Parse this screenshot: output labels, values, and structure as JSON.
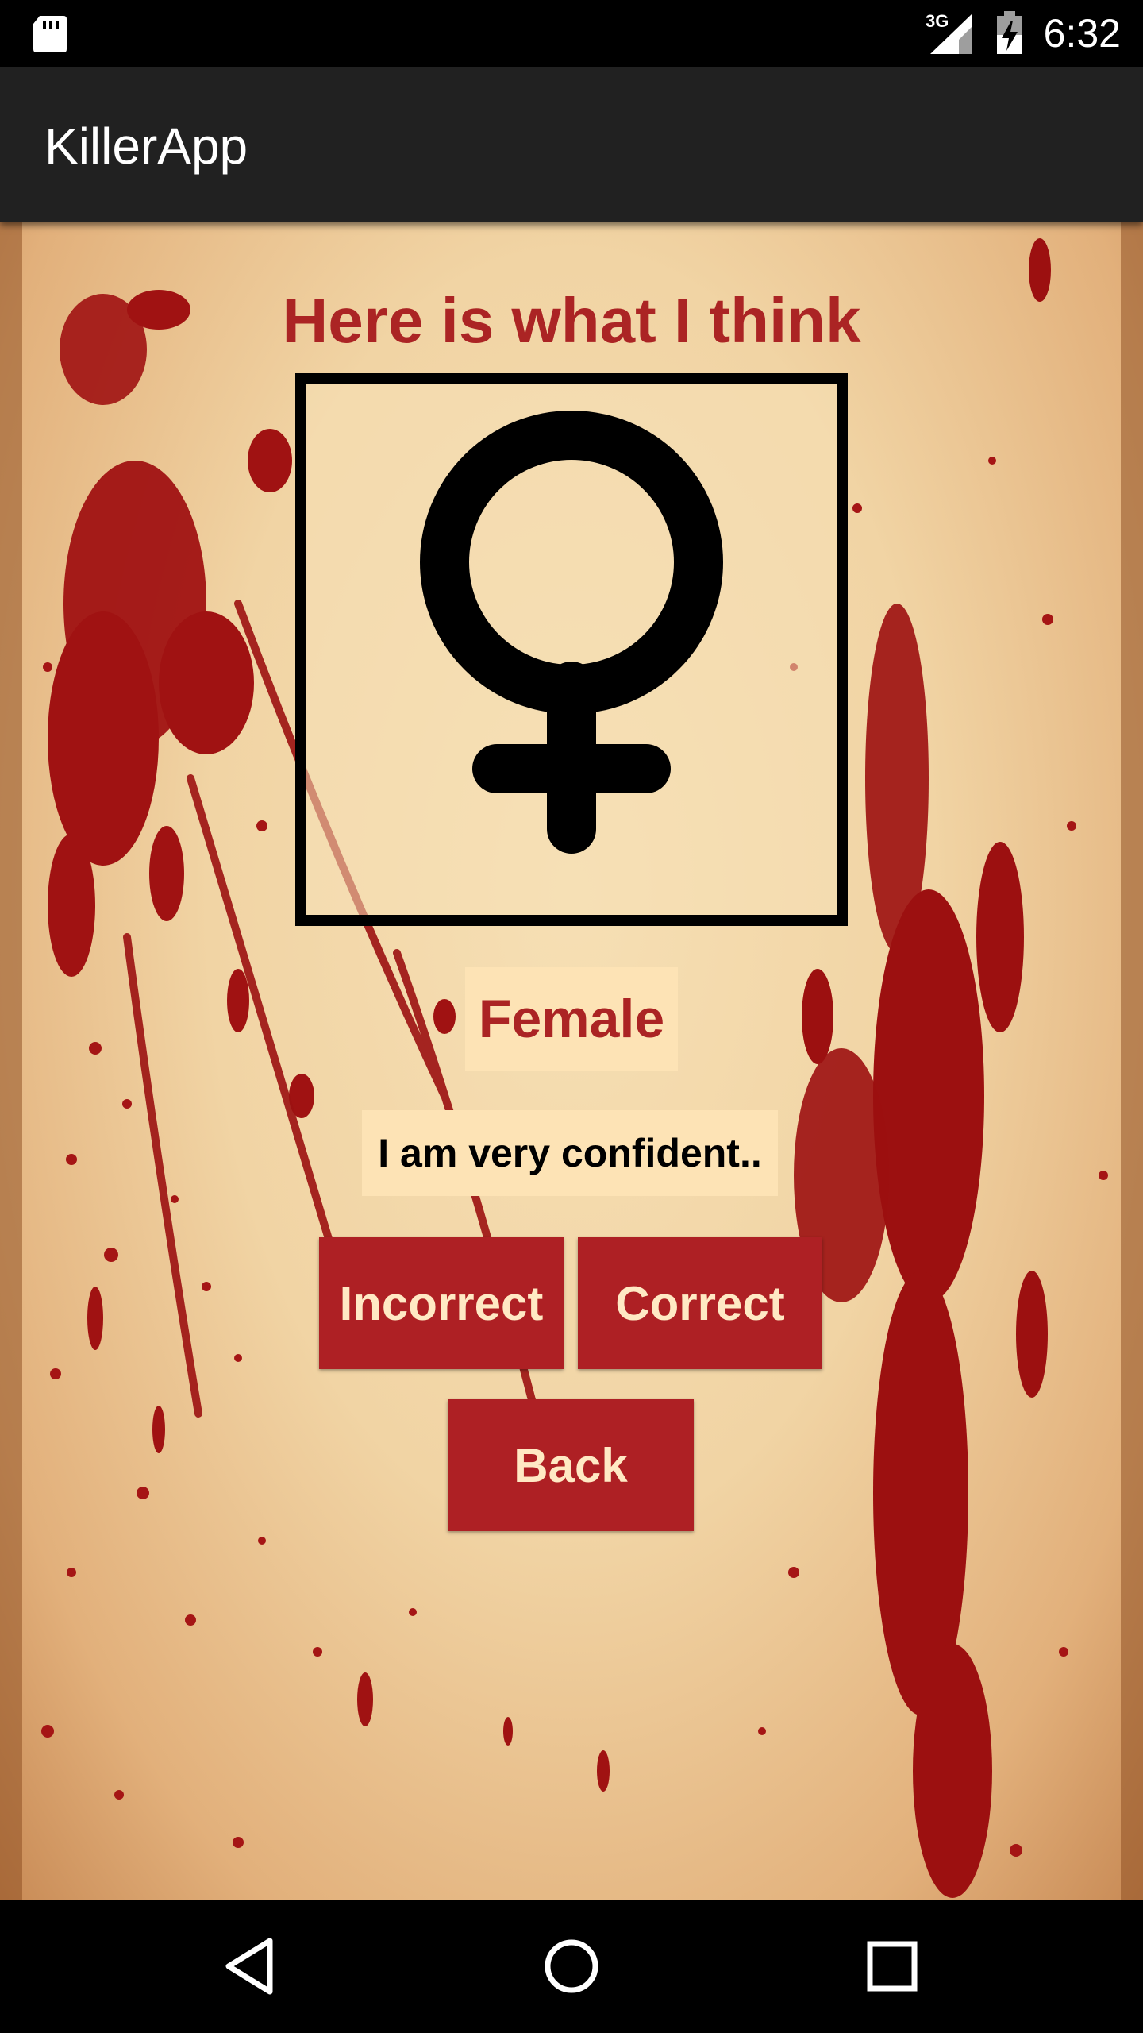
{
  "status_bar": {
    "network_type": "3G",
    "time": "6:32",
    "icons": [
      "sd-card-icon",
      "signal-icon",
      "battery-charging-icon"
    ]
  },
  "app_bar": {
    "title": "KillerApp"
  },
  "main": {
    "heading": "Here is what I think",
    "prediction_icon": "female-symbol-icon",
    "result": "Female",
    "confidence": "I am very confident..",
    "buttons": {
      "incorrect": "Incorrect",
      "correct": "Correct",
      "back": "Back"
    }
  },
  "nav_bar": {
    "icons": [
      "nav-back-icon",
      "nav-home-icon",
      "nav-recent-apps-icon"
    ]
  },
  "colors": {
    "accent_red": "#ab2424",
    "button_red": "#ae2024",
    "label_bg": "#fde3b5",
    "app_bar_bg": "#212121"
  }
}
